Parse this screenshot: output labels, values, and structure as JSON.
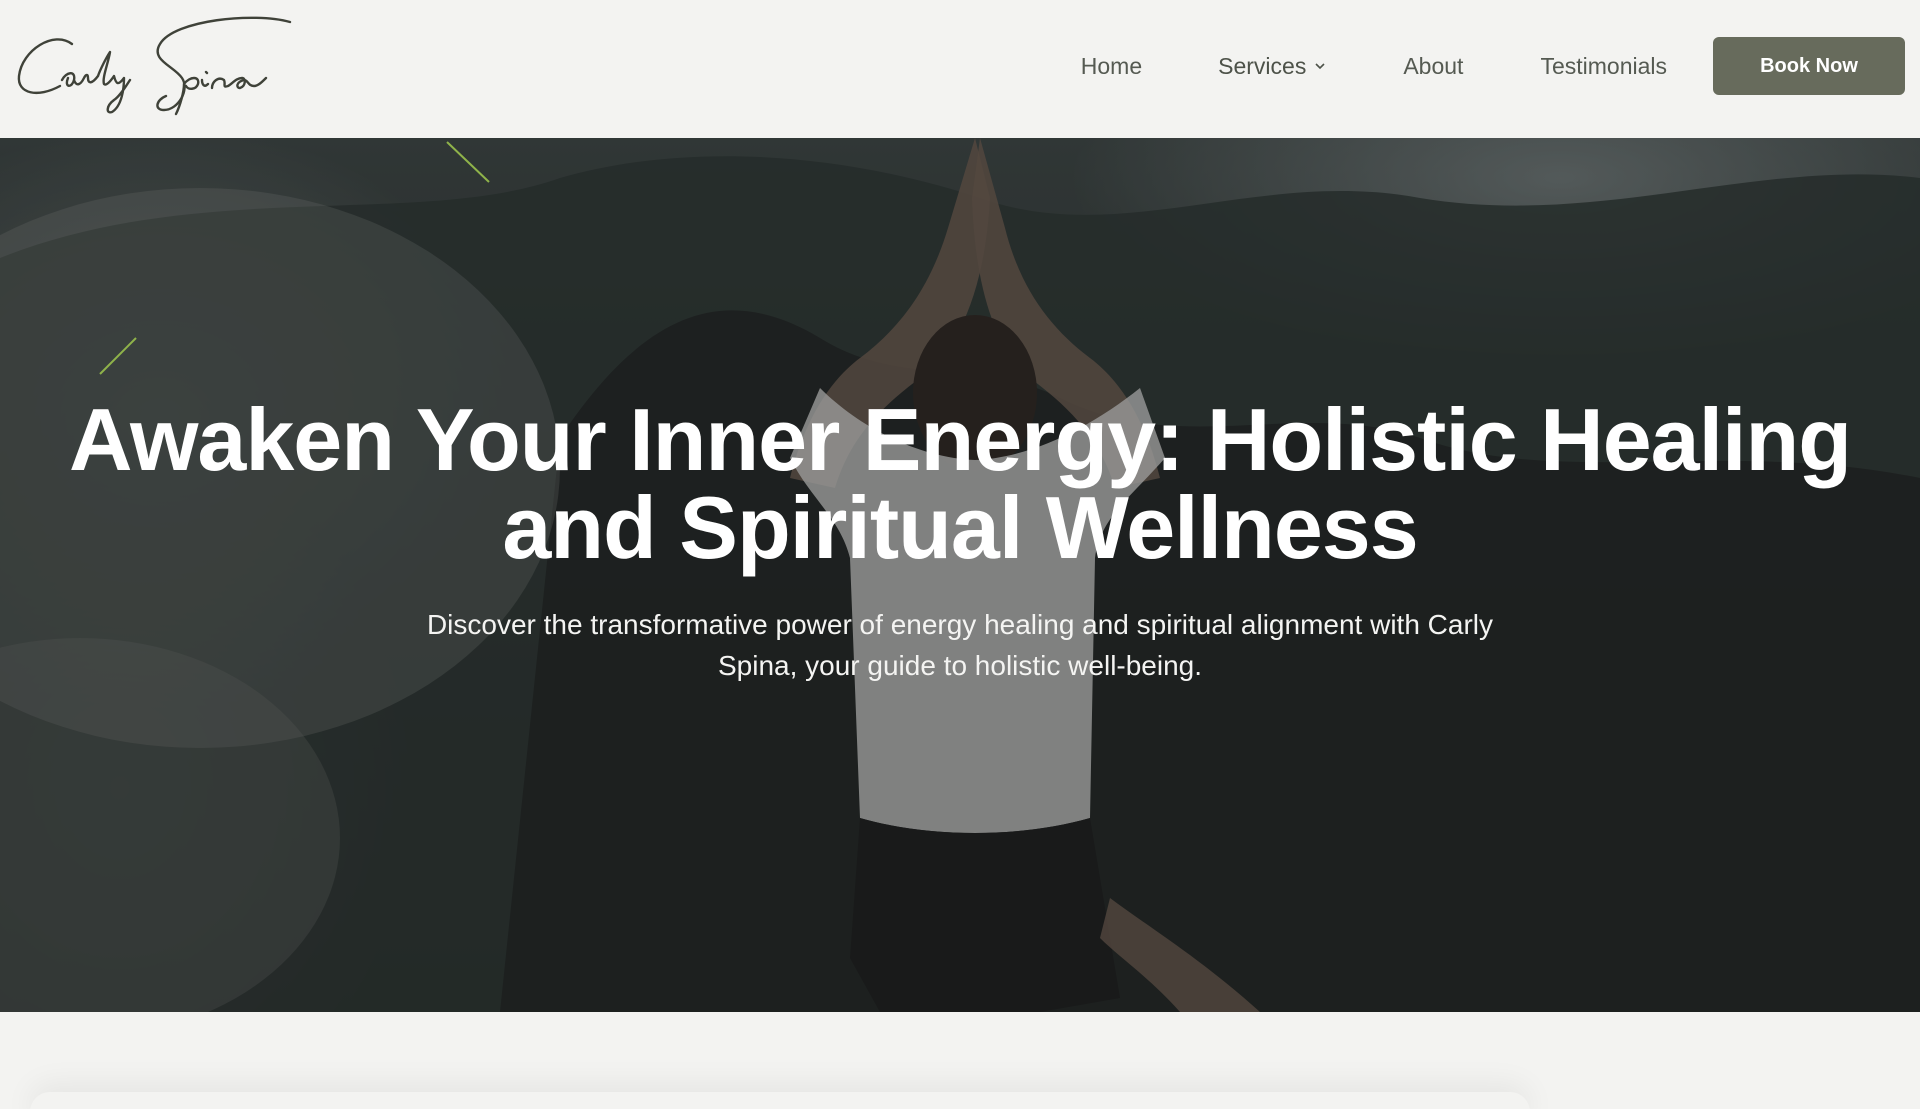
{
  "brand": {
    "logo_text": "Carly Spina"
  },
  "nav": {
    "items": [
      {
        "label": "Home"
      },
      {
        "label": "Services"
      },
      {
        "label": "About"
      },
      {
        "label": "Testimonials"
      }
    ],
    "cta_label": "Book Now"
  },
  "hero": {
    "title": "Awaken Your Inner Energy: Holistic Healing and Spiritual Wellness",
    "subtitle": "Discover the transformative power of energy healing and spiritual alignment with Carly Spina, your guide to holistic well-being."
  },
  "colors": {
    "page_background": "#f3f3f1",
    "cta_background": "#676b5c",
    "nav_text": "#555a52",
    "hero_text": "#ffffff",
    "accent_line": "#8fb34a"
  },
  "icons": {
    "services_dropdown": "chevron-down-icon"
  }
}
